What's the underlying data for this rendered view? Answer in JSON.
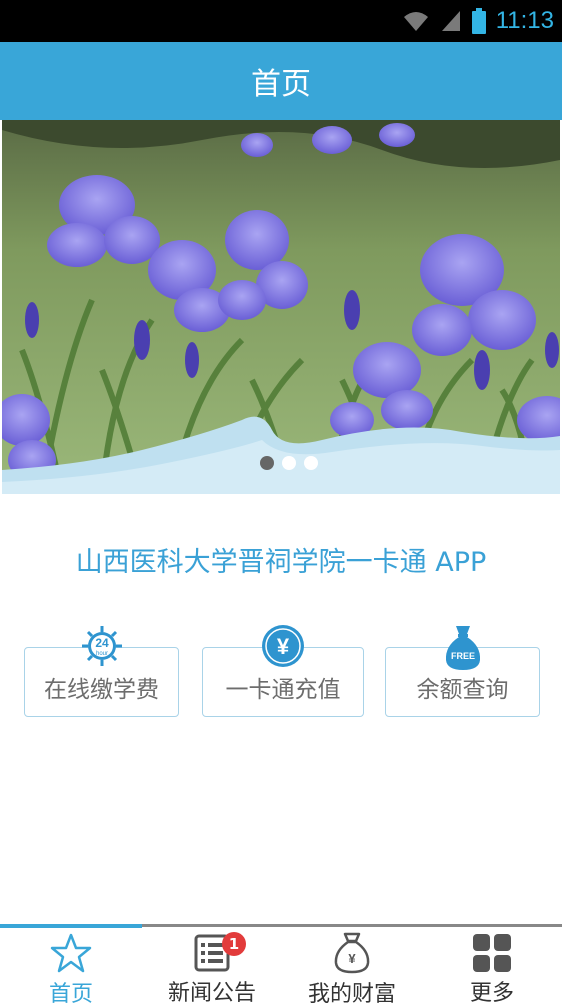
{
  "status_bar": {
    "time": "11:13",
    "time_color": "#33b5e5"
  },
  "header": {
    "title": "首页",
    "color": "#39a6d8"
  },
  "banner": {
    "image": "purple iris flowers photo",
    "dots": [
      true,
      false,
      false
    ]
  },
  "headline": "山西医科大学晋祠学院一卡通 APP",
  "actions": [
    {
      "label": "在线缴学费",
      "icon": "24-hour-icon",
      "icon_text": "24",
      "icon_subtext": "hour"
    },
    {
      "label": "一卡通充值",
      "icon": "yuan-coin-icon",
      "icon_text": "¥"
    },
    {
      "label": "余额查询",
      "icon": "free-bag-icon",
      "icon_text": "FREE"
    }
  ],
  "bottom_nav": [
    {
      "label": "首页",
      "icon": "star-icon",
      "active": true
    },
    {
      "label": "新闻公告",
      "icon": "news-list-icon",
      "badge": "1"
    },
    {
      "label": "我的财富",
      "icon": "money-bag-icon"
    },
    {
      "label": "更多",
      "icon": "grid-icon"
    }
  ],
  "accent_color": "#39a6d8"
}
